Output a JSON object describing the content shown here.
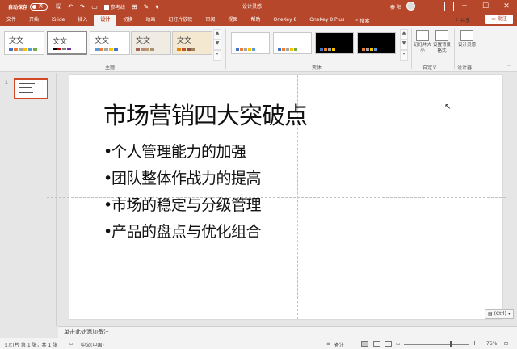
{
  "titlebar": {
    "autosave_label": "自动保存",
    "autosave_state": "关",
    "reference_label": "参考线",
    "doc_title": "设计灵感",
    "user_name": "秦 阳",
    "minimize": "─",
    "maximize": "☐",
    "close": "✕"
  },
  "tabs": [
    "文件",
    "开始",
    "iSlide",
    "插入",
    "设计",
    "切换",
    "动画",
    "幻灯片放映",
    "审阅",
    "视图",
    "帮助",
    "OneKey 8",
    "OneKey 8 Plus"
  ],
  "active_tab": "设计",
  "search_label": "搜索",
  "share_label": "共享",
  "comment_label": "批注",
  "ribbon": {
    "theme_thumb_text": "文文",
    "group_theme": "主题",
    "group_variants": "变体",
    "group_customize": "自定义",
    "group_designer": "设计器",
    "slide_size_label": "幻灯片大小",
    "format_bg_label": "设置背景格式",
    "design_ideas_label": "设计灵感"
  },
  "slide_panel": {
    "slide_number": "1"
  },
  "slide": {
    "title": "市场营销四大突破点",
    "bullets": [
      "个人管理能力的加强",
      "团队整体作战力的提高",
      "市场的稳定与分级管理",
      "产品的盘点与优化组合"
    ],
    "paste_options": "(Ctrl)"
  },
  "notes_placeholder": "单击此处添加备注",
  "statusbar": {
    "slide_info": "幻灯片 第 1 张，共 1 张",
    "language": "中文(中国)",
    "notes_label": "备注",
    "zoom_minus": "−",
    "zoom_plus": "+",
    "zoom_level": "75%"
  },
  "colors": {
    "brand": "#b7472a",
    "selected_thumb": "#d24726"
  }
}
